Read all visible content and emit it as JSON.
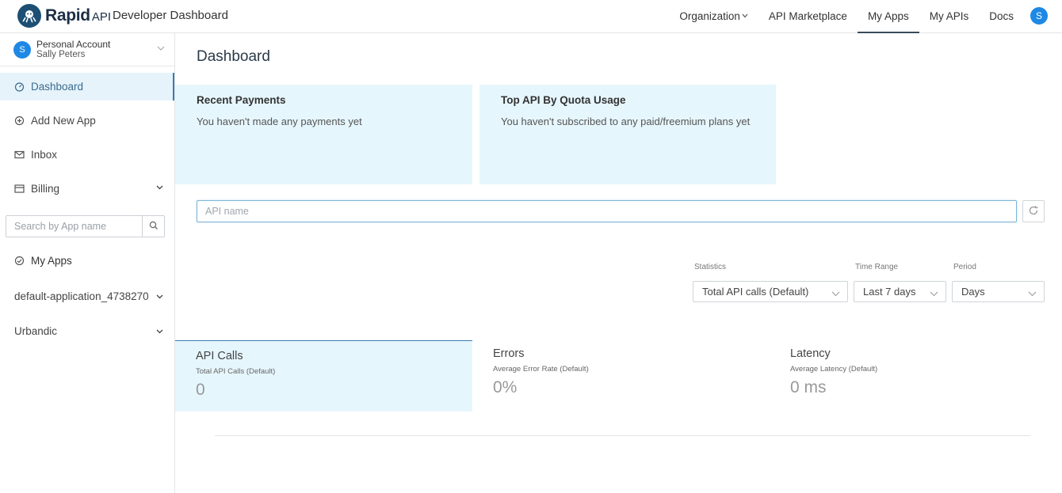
{
  "header": {
    "logo_text": "Rapid",
    "logo_suffix": "API",
    "app_title": "Developer Dashboard",
    "nav": [
      {
        "label": "Organization"
      },
      {
        "label": "API Marketplace"
      },
      {
        "label": "My Apps"
      },
      {
        "label": "My APIs"
      },
      {
        "label": "Docs"
      }
    ],
    "avatar_initial": "S"
  },
  "sidebar": {
    "account": {
      "initial": "S",
      "type": "Personal Account",
      "name": "Sally Peters"
    },
    "items": [
      {
        "label": "Dashboard",
        "icon": "dashboard-icon"
      },
      {
        "label": "Add New App",
        "icon": "add-circle-icon"
      },
      {
        "label": "Inbox",
        "icon": "mail-icon"
      },
      {
        "label": "Billing",
        "icon": "billing-icon"
      }
    ],
    "search_placeholder": "Search by App name",
    "my_apps_label": "My Apps",
    "apps": [
      {
        "label": "default-application_4738270"
      },
      {
        "label": "Urbandic"
      }
    ]
  },
  "main": {
    "title": "Dashboard",
    "cards": [
      {
        "title": "Recent Payments",
        "text": "You haven't made any payments yet"
      },
      {
        "title": "Top API By Quota Usage",
        "text": "You haven't subscribed to any paid/freemium plans yet"
      }
    ],
    "api_input_placeholder": "API name",
    "filters": {
      "statistics": {
        "label": "Statistics",
        "value": "Total API calls (Default)"
      },
      "time_range": {
        "label": "Time Range",
        "value": "Last 7 days"
      },
      "period": {
        "label": "Period",
        "value": "Days"
      }
    },
    "metrics": [
      {
        "title": "API Calls",
        "sub": "Total API Calls (Default)",
        "value": "0"
      },
      {
        "title": "Errors",
        "sub": "Average Error Rate (Default)",
        "value": "0%"
      },
      {
        "title": "Latency",
        "sub": "Average Latency (Default)",
        "value": "0 ms"
      }
    ]
  },
  "colors": {
    "accent": "#3b7cb0",
    "card_bg": "#e6f6fd",
    "avatar": "#1e88e5"
  }
}
